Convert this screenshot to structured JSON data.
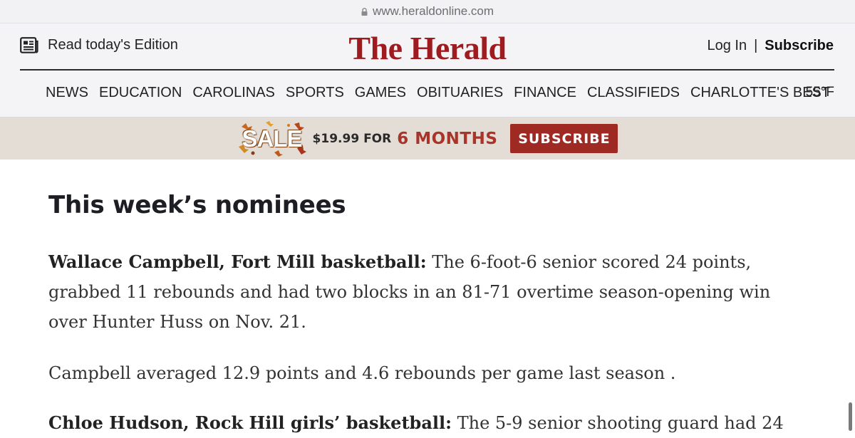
{
  "browser": {
    "url": "www.heraldonline.com"
  },
  "header": {
    "edition_label": "Read today's Edition",
    "logo": "The Herald",
    "login": "Log In",
    "separator": "|",
    "subscribe": "Subscribe",
    "nav_items": [
      "NEWS",
      "EDUCATION",
      "CAROLINAS",
      "SPORTS",
      "GAMES",
      "OBITUARIES",
      "FINANCE",
      "CLASSIFIEDS",
      "CHARLOTTE'S BEST"
    ],
    "temperature": "55°F",
    "brand_color": "#9e1b20"
  },
  "promo": {
    "badge": "SALE",
    "price": "$19.99 FOR",
    "duration": "6 MONTHS",
    "button": "SUBSCRIBE",
    "button_color": "#9e2a23",
    "background": "#e4ddd6"
  },
  "article": {
    "heading": "This week’s nominees",
    "paragraphs": [
      {
        "lead": "Wallace Campbell, Fort Mill basketball:",
        "text": " The 6-foot-6 senior scored 24 points, grabbed 11 rebounds and had two blocks in an 81-71 overtime season-opening win over Hunter Huss on Nov. 21."
      },
      {
        "lead": "",
        "text": "Campbell averaged 12.9 points and 4.6 rebounds per game last season ."
      },
      {
        "lead": "Chloe Hudson, Rock Hill girls’ basketball:",
        "text": " The 5-9 senior shooting guard had 24"
      }
    ]
  }
}
